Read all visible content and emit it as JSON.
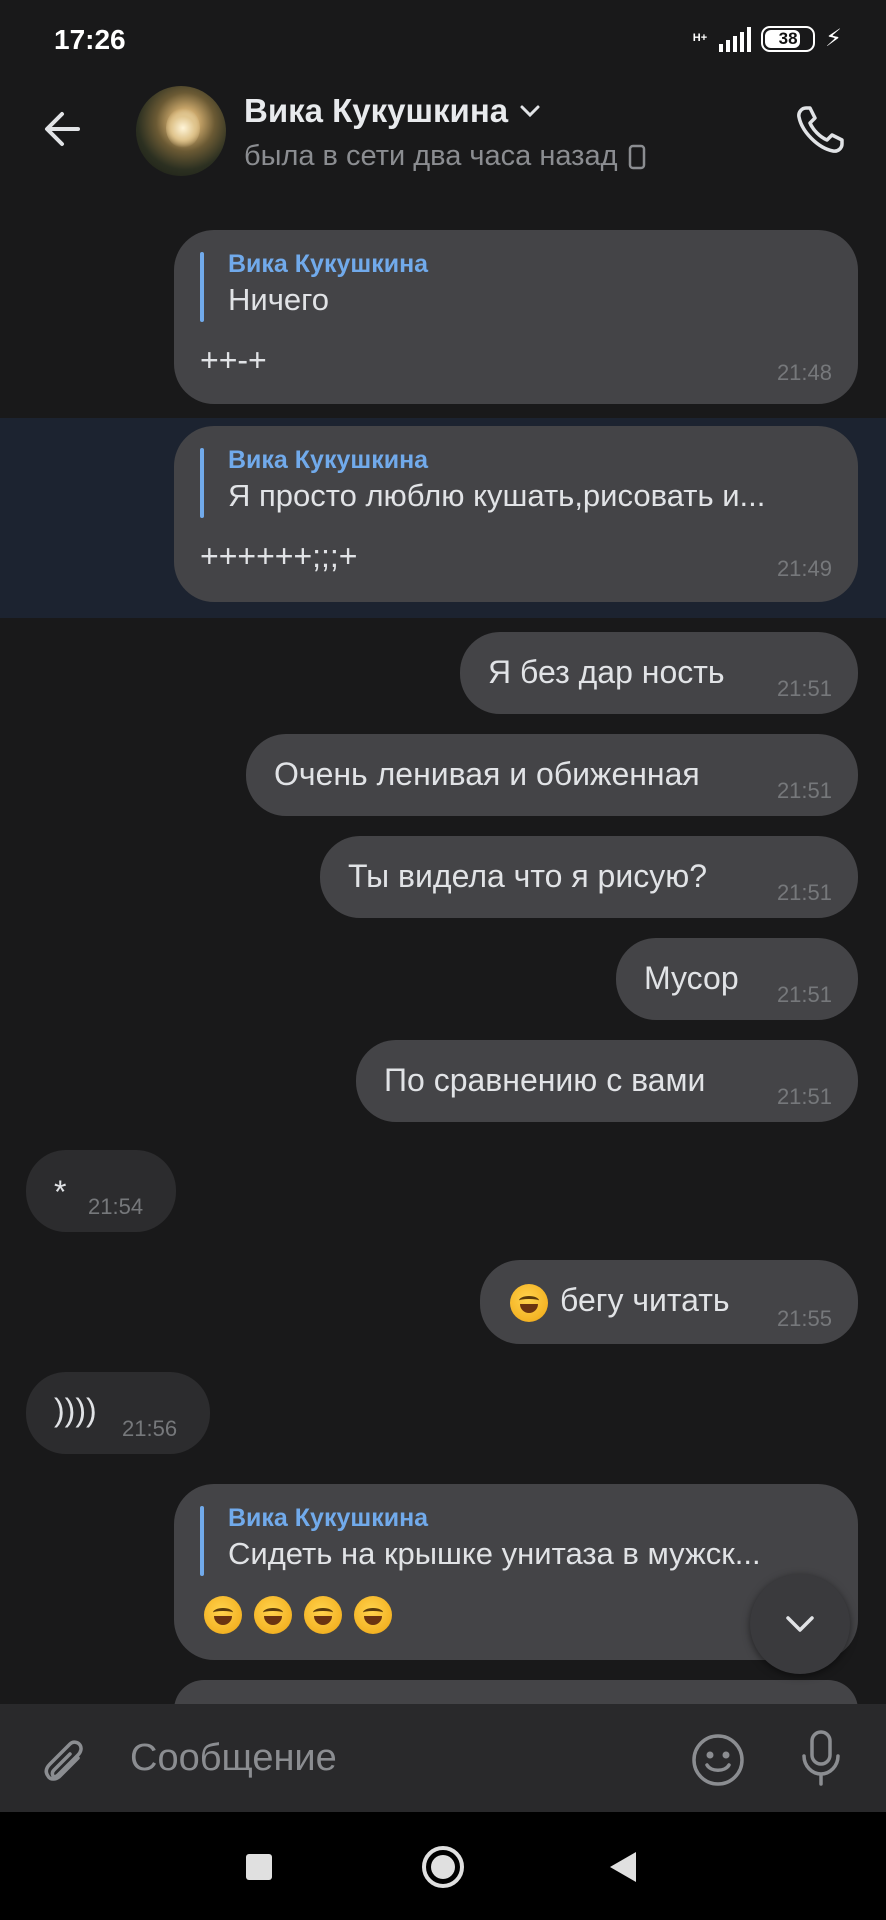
{
  "status_bar": {
    "time": "17:26",
    "network": "H+",
    "battery": "38"
  },
  "header": {
    "contact_name": "Вика Кукушкина",
    "contact_status": "была в сети два часа назад"
  },
  "messages": [
    {
      "reply_to": "Вика Кукушкина",
      "reply_text": "Ничего",
      "text": "++-+",
      "time": "21:48"
    },
    {
      "reply_to": "Вика Кукушкина",
      "reply_text": "Я просто люблю кушать,рисовать и...",
      "text": "++++++;;;+",
      "time": "21:49"
    },
    {
      "text": "Я без дар ность",
      "time": "21:51"
    },
    {
      "text": "Очень ленивая и обиженная",
      "time": "21:51"
    },
    {
      "text": "Ты видела что я рисую?",
      "time": "21:51"
    },
    {
      "text": "Мусор",
      "time": "21:51"
    },
    {
      "text": "По сравнению с вами",
      "time": "21:51"
    },
    {
      "text": "*",
      "time": "21:54"
    },
    {
      "text": "бегу читать",
      "time": "21:55"
    },
    {
      "text": "))))",
      "time": "21:56"
    },
    {
      "reply_to": "Вика Кукушкина",
      "reply_text": "Сидеть на крышке унитаза в мужск...",
      "text": "",
      "time": ""
    }
  ],
  "composer": {
    "placeholder": "Сообщение"
  },
  "icons": [
    "back-arrow-icon",
    "chevron-down-icon",
    "phone-device-icon",
    "call-icon",
    "attach-icon",
    "emoji-icon",
    "microphone-icon",
    "scroll-down-icon",
    "nav-recents-icon",
    "nav-home-icon",
    "nav-back-icon"
  ]
}
